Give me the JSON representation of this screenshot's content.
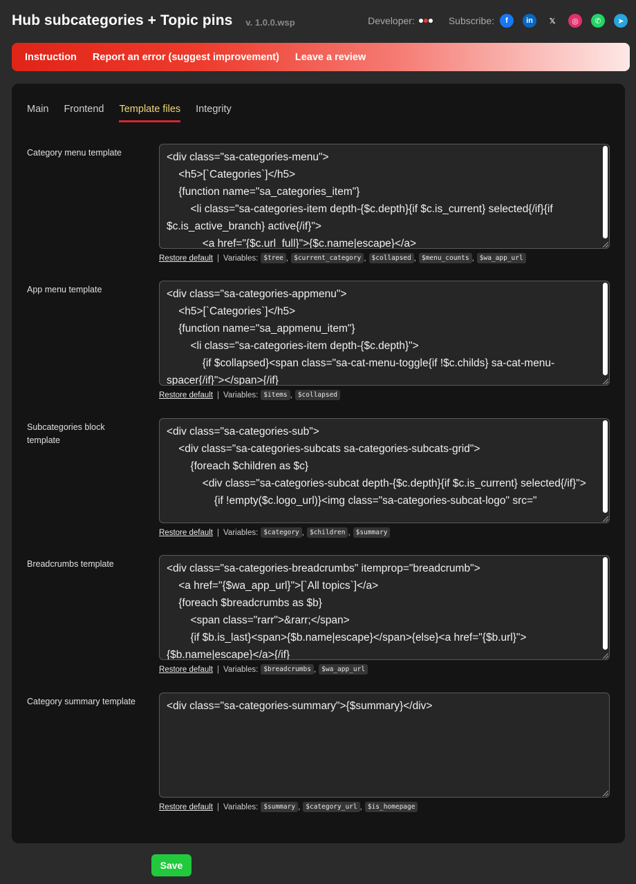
{
  "header": {
    "title": "Hub subcategories + Topic pins",
    "version": "v. 1.0.0.wsp",
    "developer_label": "Developer:",
    "subscribe_label": "Subscribe:",
    "social": [
      {
        "name": "facebook-icon",
        "glyph": "f",
        "color": "#1877f2"
      },
      {
        "name": "linkedin-icon",
        "glyph": "in",
        "color": "#0a66c2"
      },
      {
        "name": "x-icon",
        "glyph": "𝕏",
        "color": "transparent"
      },
      {
        "name": "instagram-icon",
        "glyph": "◎",
        "color": "#e1306c"
      },
      {
        "name": "whatsapp-icon",
        "glyph": "✆",
        "color": "#25d366"
      },
      {
        "name": "telegram-icon",
        "glyph": "➤",
        "color": "#2aa3e0"
      }
    ]
  },
  "banner": {
    "instruction": "Instruction",
    "report": "Report an error (suggest improvement)",
    "review": "Leave a review"
  },
  "tabs": [
    "Main",
    "Frontend",
    "Template files",
    "Integrity"
  ],
  "active_tab": "Template files",
  "restore_label": "Restore default",
  "variables_label": "Variables:",
  "templates": [
    {
      "label": "Category menu template",
      "code": "<div class=\"sa-categories-menu\">\n    <h5>[`Categories`]</h5>\n    {function name=\"sa_categories_item\"}\n        <li class=\"sa-categories-item depth-{$c.depth}{if $c.is_current} selected{/if}{if $c.is_active_branch} active{/if}\">\n            <a href=\"{$c.url_full}\">{$c.name|escape}</a>",
      "variables": [
        "$tree",
        "$current_category",
        "$collapsed",
        "$menu_counts",
        "$wa_app_url"
      ]
    },
    {
      "label": "App menu template",
      "code": "<div class=\"sa-categories-appmenu\">\n    <h5>[`Categories`]</h5>\n    {function name=\"sa_appmenu_item\"}\n        <li class=\"sa-categories-item depth-{$c.depth}\">\n            {if $collapsed}<span class=\"sa-cat-menu-toggle{if !$c.childs} sa-cat-menu-spacer{/if}\"></span>{/if}",
      "variables": [
        "$items",
        "$collapsed"
      ]
    },
    {
      "label": "Subcategories block template",
      "code": "<div class=\"sa-categories-sub\">\n    <div class=\"sa-categories-subcats sa-categories-subcats-grid\">\n        {foreach $children as $c}\n            <div class=\"sa-categories-subcat depth-{$c.depth}{if $c.is_current} selected{/if}\">\n                {if !empty($c.logo_url)}<img class=\"sa-categories-subcat-logo\" src=\"",
      "variables": [
        "$category",
        "$children",
        "$summary"
      ]
    },
    {
      "label": "Breadcrumbs template",
      "code": "<div class=\"sa-categories-breadcrumbs\" itemprop=\"breadcrumb\">\n    <a href=\"{$wa_app_url}\">[`All topics`]</a>\n    {foreach $breadcrumbs as $b}\n        <span class=\"rarr\">&rarr;</span>\n        {if $b.is_last}<span>{$b.name|escape}</span>{else}<a href=\"{$b.url}\">{$b.name|escape}</a>{/if}",
      "variables": [
        "$breadcrumbs",
        "$wa_app_url"
      ]
    },
    {
      "label": "Category summary template",
      "code": "<div class=\"sa-categories-summary\">{$summary}</div>",
      "variables": [
        "$summary",
        "$category_url",
        "$is_homepage"
      ]
    }
  ],
  "save_label": "Save"
}
